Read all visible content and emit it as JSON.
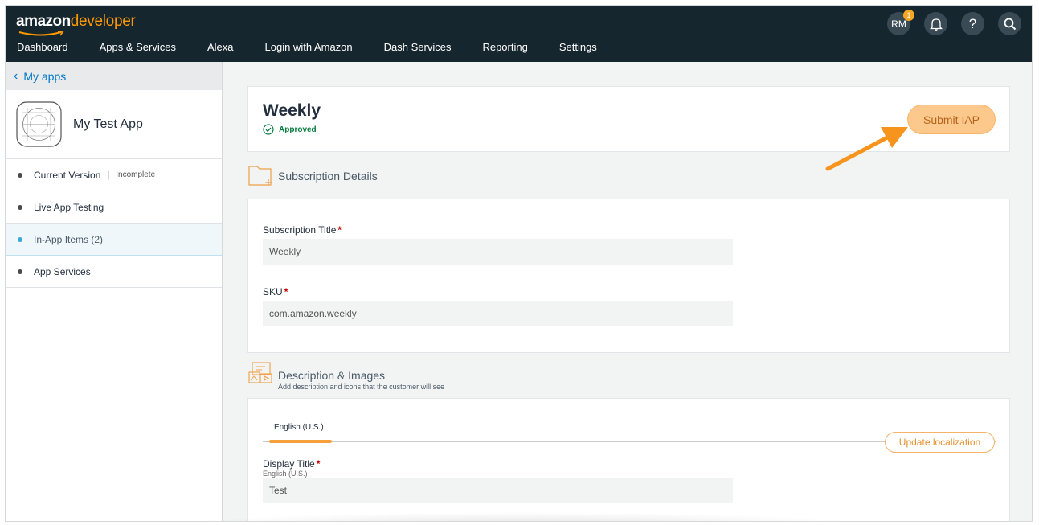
{
  "brand": {
    "name_bold": "amazon",
    "name_light": "developer"
  },
  "menu": [
    "Dashboard",
    "Apps & Services",
    "Alexa",
    "Login with Amazon",
    "Dash Services",
    "Reporting",
    "Settings"
  ],
  "topbar": {
    "avatar_initials": "RM",
    "notification_count": "1",
    "help_label": "?"
  },
  "sidebar": {
    "back_label": "My apps",
    "app_name": "My Test App",
    "items": [
      {
        "label": "Current Version",
        "status": "Incomplete"
      },
      {
        "label": "Live App Testing"
      },
      {
        "label": "In-App Items (2)"
      },
      {
        "label": "App Services"
      }
    ]
  },
  "header": {
    "title": "Weekly",
    "status": "Approved",
    "submit_label": "Submit IAP"
  },
  "subscription": {
    "heading": "Subscription Details",
    "title_label": "Subscription Title",
    "title_value": "Weekly",
    "sku_label": "SKU",
    "sku_value": "com.amazon.weekly"
  },
  "description": {
    "heading": "Description & Images",
    "subheading": "Add description and icons that the customer will see",
    "tab_label": "English (U.S.)",
    "update_label": "Update localization",
    "display_title_label": "Display Title",
    "display_title_locale": "English (U.S.)",
    "display_title_value": "Test"
  },
  "colors": {
    "nav_bg": "#16262e",
    "accent": "#ff9900",
    "link": "#0077c8",
    "approved": "#067d3f"
  }
}
